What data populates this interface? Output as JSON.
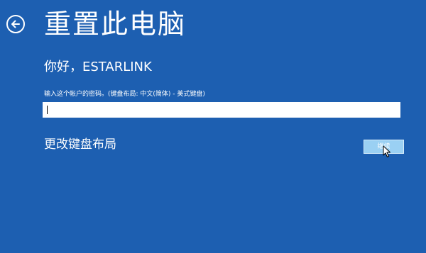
{
  "header": {
    "back_icon": "back-arrow-icon",
    "title": "重置此电脑"
  },
  "greeting": "你好，ESTARLINK",
  "password_prompt": "输入这个帐户的密码。(键盘布局: 中文(简体) - 美式键盘)",
  "password_input": {
    "value": ""
  },
  "change_keyboard_label": "更改键盘布局",
  "continue_label": "继续",
  "colors": {
    "background": "#1d5fb1",
    "button": "#9ad0f3",
    "text": "#ffffff"
  }
}
